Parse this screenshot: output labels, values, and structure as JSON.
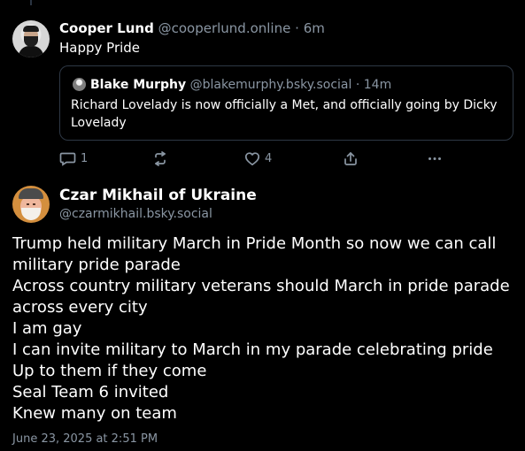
{
  "colors": {
    "background": "#000000",
    "text": "#ffffff",
    "muted": "#8a96a3",
    "border": "#2e3845"
  },
  "reply_post": {
    "author_name": "Cooper Lund",
    "author_handle": "@cooperlund.online",
    "separator": "·",
    "time": "6m",
    "text": "Happy Pride",
    "quote": {
      "author_name": "Blake Murphy",
      "author_handle": "@blakemurphy.bsky.social",
      "separator": "·",
      "time": "14m",
      "text": "Richard Lovelady is now officially a Met, and officially going by Dicky Lovelady"
    },
    "actions": {
      "reply_icon": "reply-icon",
      "reply_count": "1",
      "repost_icon": "repost-icon",
      "like_icon": "heart-icon",
      "like_count": "4",
      "share_icon": "share-icon",
      "more_icon": "more-icon"
    }
  },
  "main_post": {
    "author_name": "Czar Mikhail of Ukraine",
    "author_handle": "@czarmikhail.bsky.social",
    "lines": [
      "Trump held military March in Pride Month so now we can call military pride parade",
      "Across country military veterans should March in pride parade across every city",
      "I am gay",
      "I can invite military to March in my parade celebrating pride",
      "Up to them if they come",
      "Seal Team 6 invited",
      "Knew many on team"
    ],
    "timestamp": "June 23, 2025 at 2:51 PM"
  }
}
